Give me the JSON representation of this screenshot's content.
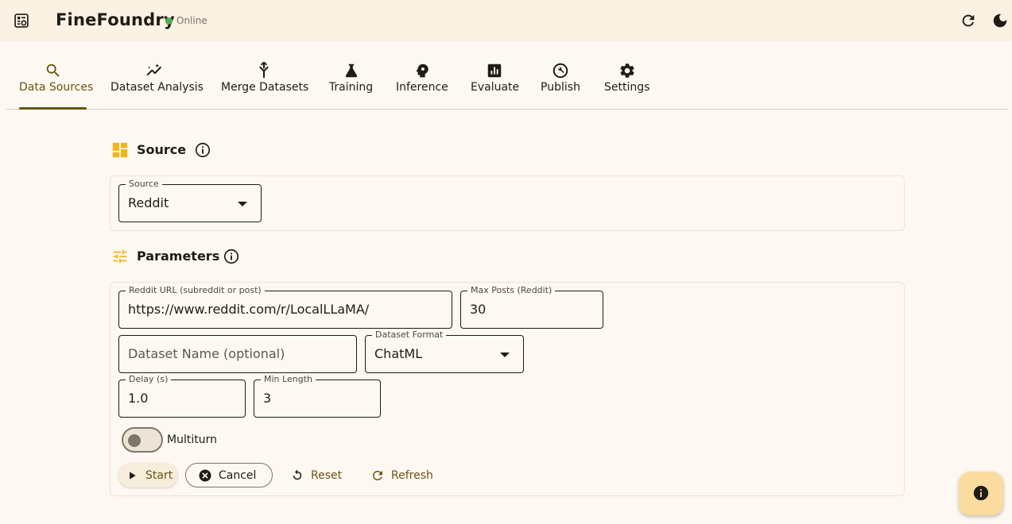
{
  "app": {
    "title": "FineFoundry",
    "status": "Online",
    "status_color": "#4caf50",
    "icons": {
      "logo": "app-logo-icon",
      "refresh": "refresh-icon",
      "theme": "dark-mode-icon"
    }
  },
  "tabs": [
    {
      "label": "Data Sources",
      "icon": "search-icon",
      "active": true
    },
    {
      "label": "Dataset Analysis",
      "icon": "insights-icon",
      "active": false
    },
    {
      "label": "Merge Datasets",
      "icon": "merge-icon",
      "active": false
    },
    {
      "label": "Training",
      "icon": "science-flask-icon",
      "active": false
    },
    {
      "label": "Inference",
      "icon": "psychology-icon",
      "active": false
    },
    {
      "label": "Evaluate",
      "icon": "bar-chart-icon",
      "active": false
    },
    {
      "label": "Publish",
      "icon": "build-circle-icon",
      "active": false
    },
    {
      "label": "Settings",
      "icon": "gear-icon",
      "active": false
    }
  ],
  "source_section": {
    "title": "Source",
    "icon": "dashboard-icon",
    "source_field": {
      "label": "Source",
      "value": "Reddit"
    }
  },
  "parameters_section": {
    "title": "Parameters",
    "icon": "tune-icon",
    "reddit_url": {
      "label": "Reddit URL (subreddit or post)",
      "value": "https://www.reddit.com/r/LocalLLaMA/"
    },
    "max_posts": {
      "label": "Max Posts (Reddit)",
      "value": "30"
    },
    "dataset_name": {
      "placeholder": "Dataset Name (optional)",
      "value": ""
    },
    "dataset_format": {
      "label": "Dataset Format",
      "value": "ChatML"
    },
    "delay": {
      "label": "Delay (s)",
      "value": "1.0"
    },
    "min_length": {
      "label": "Min Length",
      "value": "3"
    },
    "multiturn": {
      "label": "Multiturn",
      "enabled": false
    }
  },
  "actions": {
    "start": "Start",
    "cancel": "Cancel",
    "reset": "Reset",
    "refresh": "Refresh"
  },
  "colors": {
    "accent": "#6b5310",
    "section_icon": "#f2b41d",
    "fab": "#fbdc9e",
    "background": "#fdf8f1"
  }
}
